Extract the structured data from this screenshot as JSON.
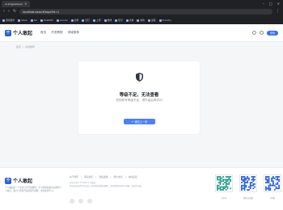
{
  "browser": {
    "tab_title": "ai.xinguaixuan",
    "url": "localhost:xxxx/#/login?id=1",
    "bookmarks": [
      "游戏服务",
      "Gitea",
      "Git",
      "ChatGPT",
      "vscode",
      "新增",
      "钉钉",
      "上传",
      "微博",
      "知乎",
      "文章",
      "博客",
      "读取",
      "Foundry"
    ]
  },
  "header": {
    "logo_char": "个",
    "logo_text": "个人敢起",
    "nav": [
      "首页",
      "开发教程",
      "领域推荐"
    ],
    "login_label": "登录"
  },
  "breadcrumb": [
    "首页",
    "/",
    "领域推荐"
  ],
  "card": {
    "title": "等级不足，无法查看",
    "desc": "您的账号等级不足，请升级后再访问",
    "button_label": "返回上一页"
  },
  "footer": {
    "logo_char": "个",
    "logo_text": "个人敢起",
    "description": "个人敢起是一个专注分享开发教程、学习资源和技术实践的个人站点，致力于帮助开发者提升技能，欢迎交流学习。",
    "links": [
      "关于我们",
      "|",
      "联系我们",
      "|",
      "隐私政策",
      "|",
      "用户协议",
      "|",
      "友情链接"
    ],
    "copyright": "Copyright © 2024 个人敢起",
    "icp": "本站内容仅供学习交流，如有侵权请联系删除，所有资源均来源于网络，请支持正版。",
    "qr_codes": [
      {
        "caption": "公众号"
      },
      {
        "caption": "微信交流群"
      },
      {
        "caption": "QQ群"
      }
    ]
  },
  "colors": {
    "primary": "#3a6ff2",
    "button": "#4c7ff2",
    "lock": "#2f3640",
    "chrome": "#202124"
  }
}
